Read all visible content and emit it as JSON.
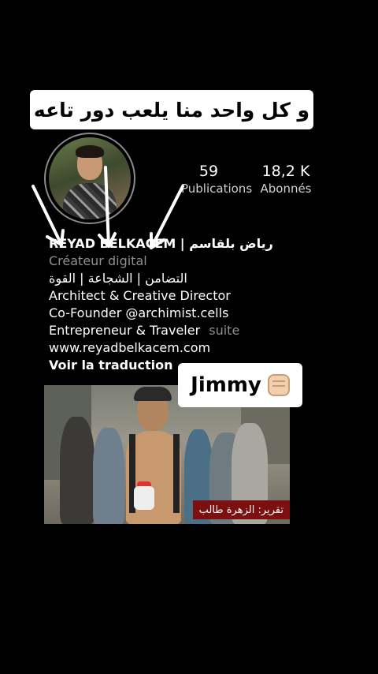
{
  "caption": {
    "text": "و كل واحد منا يلعب دور تاعه"
  },
  "profile": {
    "stats": [
      {
        "count": "59",
        "label": "Publications"
      },
      {
        "count": "18,2 K",
        "label": "Abonnés"
      }
    ],
    "name": "REYAD BELKACEM | رياض بلقاسم",
    "category": "Créateur digital",
    "bio_lines": [
      "التضامن | الشجاعة | القوة",
      "Architect & Creative Director",
      "Co-Founder @archimist.cells",
      "Entrepreneur & Traveler"
    ],
    "more_label": "suite",
    "website": "www.reyadbelkacem.com",
    "translate_label": "Voir la traduction"
  },
  "sticker": {
    "text": "Jimmy",
    "icon": "raised-fist-icon"
  },
  "video": {
    "lower_third": "تقرير: الزهرة طالب"
  },
  "colors": {
    "background": "#000000",
    "muted": "#8f8f8f",
    "caption_bg": "#ffffff"
  }
}
